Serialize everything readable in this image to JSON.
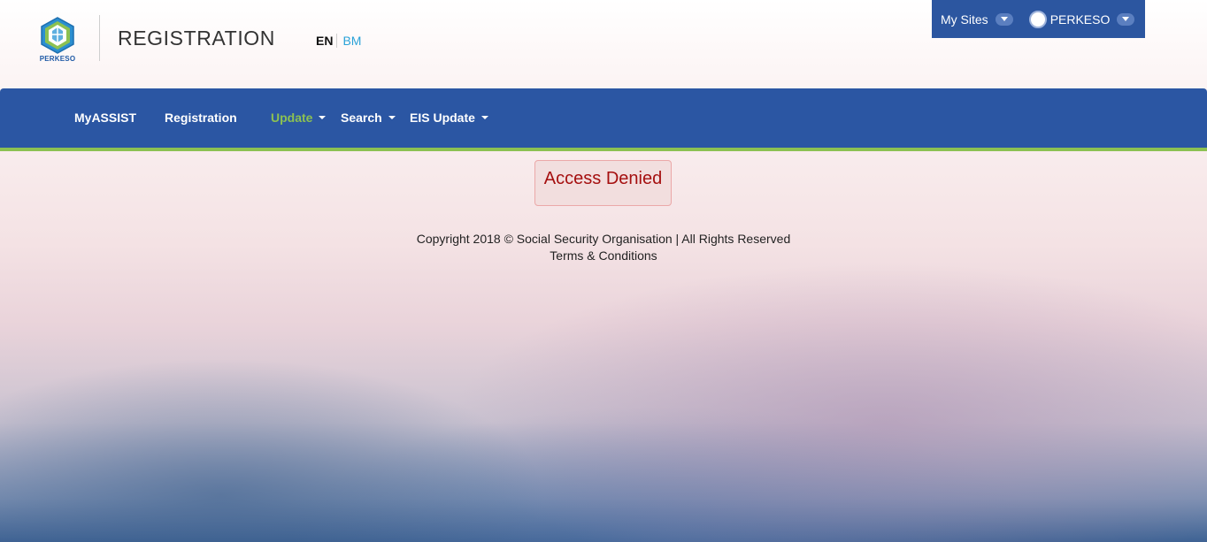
{
  "header": {
    "logo_text": "PERKESO",
    "app_title": "REGISTRATION",
    "lang_en": "EN",
    "lang_bm": "BM"
  },
  "topbar": {
    "my_sites": "My Sites",
    "user_name": "PERKESO"
  },
  "nav": {
    "items": [
      {
        "label": "MyASSIST"
      },
      {
        "label": "Registration"
      },
      {
        "label": "Update"
      },
      {
        "label": "Search"
      },
      {
        "label": "EIS Update"
      }
    ],
    "active": "Update"
  },
  "alert": {
    "message": "Access Denied"
  },
  "footer": {
    "copyright": "Copyright 2018 © Social Security Organisation | All Rights Reserved",
    "terms": "Terms & Conditions"
  },
  "colors": {
    "nav_bg": "#2b56a3",
    "nav_accent": "#8cc152",
    "alert_text": "#a50f0f",
    "alert_bg": "#f2dede",
    "lang_bm": "#2aa2d8"
  }
}
